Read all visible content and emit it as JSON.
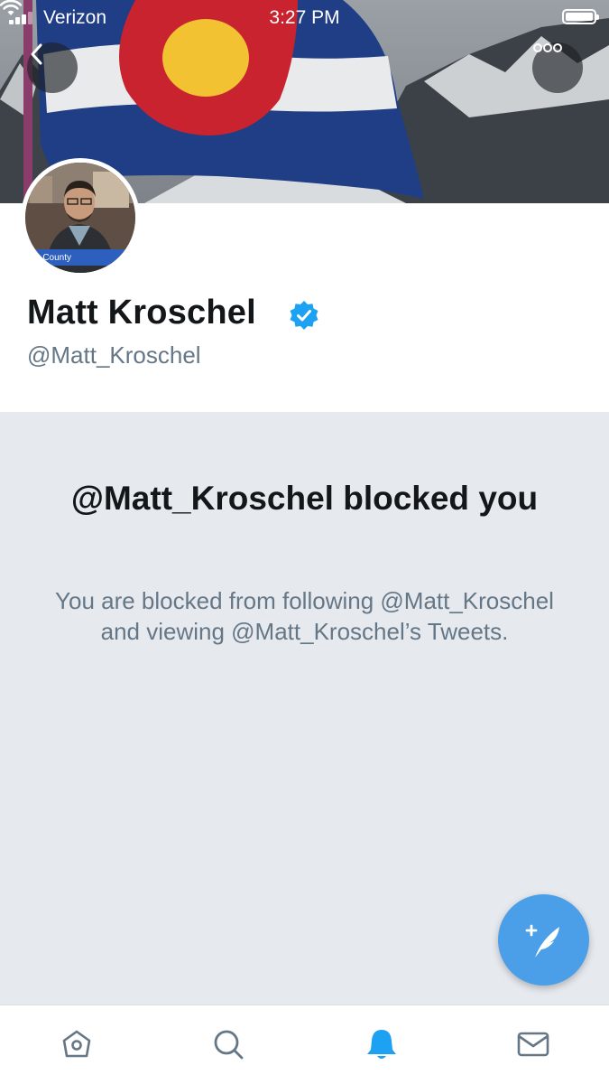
{
  "status_bar": {
    "carrier": "Verizon",
    "time": "3:27 PM"
  },
  "header": {
    "avatar_caption": "nit County"
  },
  "profile": {
    "name": "Matt Kroschel",
    "handle": "@Matt_Kroschel",
    "verified": true
  },
  "blocked": {
    "title": "@Matt_Kroschel blocked you",
    "message": "You are blocked from following @Matt_Kroschel and viewing @Matt_Kroschel’s Tweets."
  },
  "tabs": [
    {
      "icon": "home-icon",
      "active": false
    },
    {
      "icon": "search-icon",
      "active": false
    },
    {
      "icon": "notifications-bell-icon",
      "active": true
    },
    {
      "icon": "messages-envelope-icon",
      "active": false
    }
  ],
  "colors": {
    "accent": "#1da1f2",
    "compose": "#4a9fe8",
    "panel_bg": "#e6e9ee",
    "muted_text": "#657786",
    "inactive_icon": "#657786"
  }
}
